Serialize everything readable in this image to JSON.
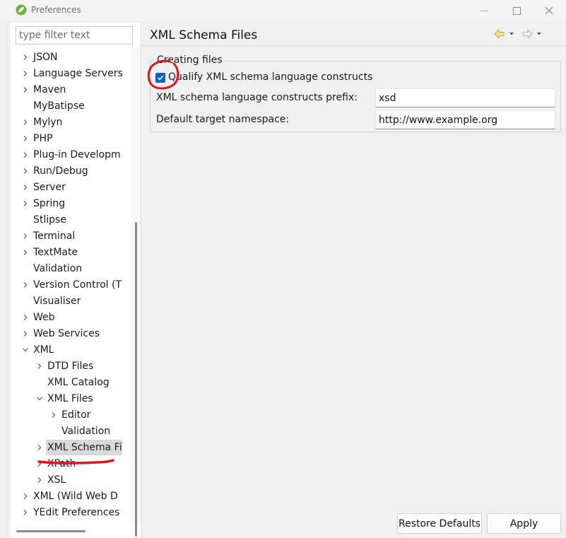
{
  "window": {
    "title": "Preferences"
  },
  "sidebar": {
    "filter_placeholder": "type filter text",
    "items": [
      {
        "label": "JSON",
        "expander": "collapsed"
      },
      {
        "label": "Language Servers",
        "expander": "collapsed"
      },
      {
        "label": "Maven",
        "expander": "collapsed"
      },
      {
        "label": "MyBatipse",
        "expander": "none"
      },
      {
        "label": "Mylyn",
        "expander": "collapsed"
      },
      {
        "label": "PHP",
        "expander": "collapsed"
      },
      {
        "label": "Plug-in Developm",
        "expander": "collapsed"
      },
      {
        "label": "Run/Debug",
        "expander": "collapsed"
      },
      {
        "label": "Server",
        "expander": "collapsed"
      },
      {
        "label": "Spring",
        "expander": "collapsed"
      },
      {
        "label": "Stlipse",
        "expander": "none"
      },
      {
        "label": "Terminal",
        "expander": "collapsed"
      },
      {
        "label": "TextMate",
        "expander": "collapsed"
      },
      {
        "label": "Validation",
        "expander": "none"
      },
      {
        "label": "Version Control (T",
        "expander": "collapsed"
      },
      {
        "label": "Visualiser",
        "expander": "none"
      },
      {
        "label": "Web",
        "expander": "collapsed"
      },
      {
        "label": "Web Services",
        "expander": "collapsed"
      },
      {
        "label": "XML",
        "expander": "expanded"
      },
      {
        "label": "DTD Files",
        "expander": "collapsed"
      },
      {
        "label": "XML Catalog",
        "expander": "none"
      },
      {
        "label": "XML Files",
        "expander": "expanded"
      },
      {
        "label": "Editor",
        "expander": "collapsed"
      },
      {
        "label": "Validation",
        "expander": "none"
      },
      {
        "label": "XML Schema Fi",
        "expander": "collapsed",
        "selected": true
      },
      {
        "label": "XPath",
        "expander": "collapsed"
      },
      {
        "label": "XSL",
        "expander": "collapsed"
      },
      {
        "label": "XML (Wild Web D",
        "expander": "collapsed"
      },
      {
        "label": "YEdit Preferences",
        "expander": "collapsed"
      }
    ]
  },
  "main": {
    "title": "XML Schema Files",
    "group": {
      "legend": "Creating files",
      "qualify_label": "Qualify XML schema language constructs",
      "qualify_checked": true,
      "prefix_label": "XML schema language constructs prefix:",
      "prefix_value": "xsd",
      "namespace_label": "Default target namespace:",
      "namespace_value": "http://www.example.org"
    }
  },
  "buttons": {
    "restore_defaults": "Restore Defaults",
    "apply": "Apply"
  },
  "colors": {
    "checkbox_accent": "#0a5fc4",
    "annotation_red": "#e5101e",
    "nav_back_arrow": "#e8b43a"
  }
}
